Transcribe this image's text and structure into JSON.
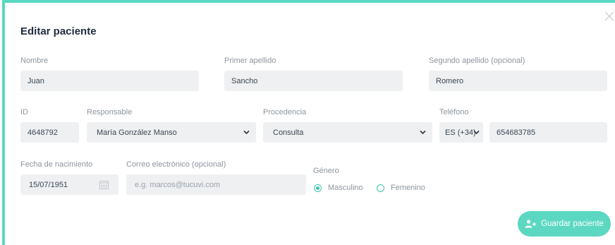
{
  "dialog": {
    "title": "Editar paciente"
  },
  "fields": {
    "nombre": {
      "label": "Nombre",
      "value": "Juan"
    },
    "primer_apellido": {
      "label": "Primer apellido",
      "value": "Sancho"
    },
    "segundo_apellido": {
      "label": "Segundo apellido (opcional)",
      "value": "Romero"
    },
    "id": {
      "label": "ID",
      "value": "4648792"
    },
    "responsable": {
      "label": "Responsable",
      "value": "María González Manso"
    },
    "procedencia": {
      "label": "Procedencia",
      "value": "Consulta"
    },
    "telefono": {
      "label": "Teléfono",
      "prefix": "ES (+34)",
      "value": "654683785"
    },
    "fecha_nacimiento": {
      "label": "Fecha de nacimiento",
      "value": "15/07/1951"
    },
    "correo": {
      "label": "Correo electrónico (opcional)",
      "placeholder": "e.g. marcos@tucuvi.com"
    },
    "genero": {
      "label": "Género",
      "options": [
        {
          "label": "Masculino",
          "selected": true
        },
        {
          "label": "Femenino",
          "selected": false
        }
      ]
    }
  },
  "actions": {
    "save_label": "Guardar paciente"
  },
  "colors": {
    "accent": "#5cd8c2",
    "field_bg": "#eef0f2",
    "title": "#1f2b3d"
  },
  "icons": {
    "close": "close-icon",
    "calendar": "calendar-icon",
    "dropdown": "chevron-down-icon",
    "save": "add-user-icon"
  }
}
